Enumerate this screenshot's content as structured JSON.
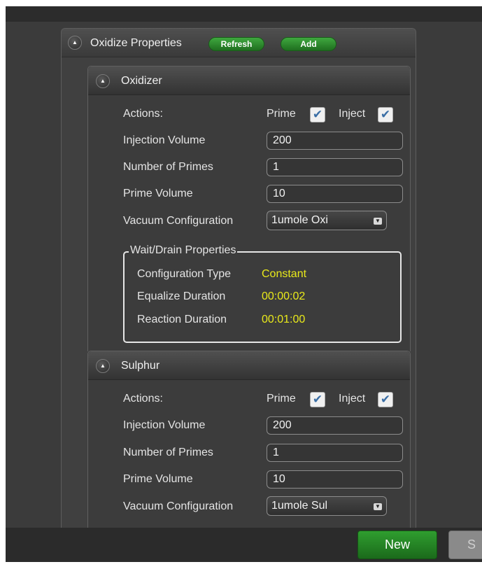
{
  "oxidize": {
    "title": "Oxidize Properties",
    "refresh_label": "Refresh",
    "add_label": "Add"
  },
  "oxidizer": {
    "title": "Oxidizer",
    "actions_label": "Actions:",
    "prime_label": "Prime",
    "prime_checked": true,
    "inject_label": "Inject",
    "inject_checked": true,
    "injection_volume_label": "Injection Volume",
    "injection_volume": "200",
    "num_primes_label": "Number of Primes",
    "num_primes": "1",
    "prime_volume_label": "Prime Volume",
    "prime_volume": "10",
    "vacuum_label": "Vacuum Configuration",
    "vacuum_value": "1umole Oxi",
    "wait_drain": {
      "legend": "Wait/Drain Properties",
      "config_type_label": "Configuration Type",
      "config_type_value": "Constant",
      "equalize_label": "Equalize Duration",
      "equalize_value": "00:00:02",
      "reaction_label": "Reaction Duration",
      "reaction_value": "00:01:00"
    }
  },
  "sulphur": {
    "title": "Sulphur",
    "actions_label": "Actions:",
    "prime_label": "Prime",
    "prime_checked": true,
    "inject_label": "Inject",
    "inject_checked": true,
    "injection_volume_label": "Injection Volume",
    "injection_volume": "200",
    "num_primes_label": "Number of Primes",
    "num_primes": "1",
    "prime_volume_label": "Prime Volume",
    "prime_volume": "10",
    "vacuum_label": "Vacuum Configuration",
    "vacuum_value": "1umole Sul"
  },
  "footer": {
    "new_label": "New",
    "save_label": "S"
  },
  "icons": {
    "collapse": "collapse-up-icon",
    "checkmark": "checkmark-icon",
    "dropdown": "dropdown-arrow-icon"
  },
  "colors": {
    "accent_green": "#2f9e2f",
    "highlight_yellow": "#e9e91a",
    "panel_bg": "#3b3b3b"
  }
}
